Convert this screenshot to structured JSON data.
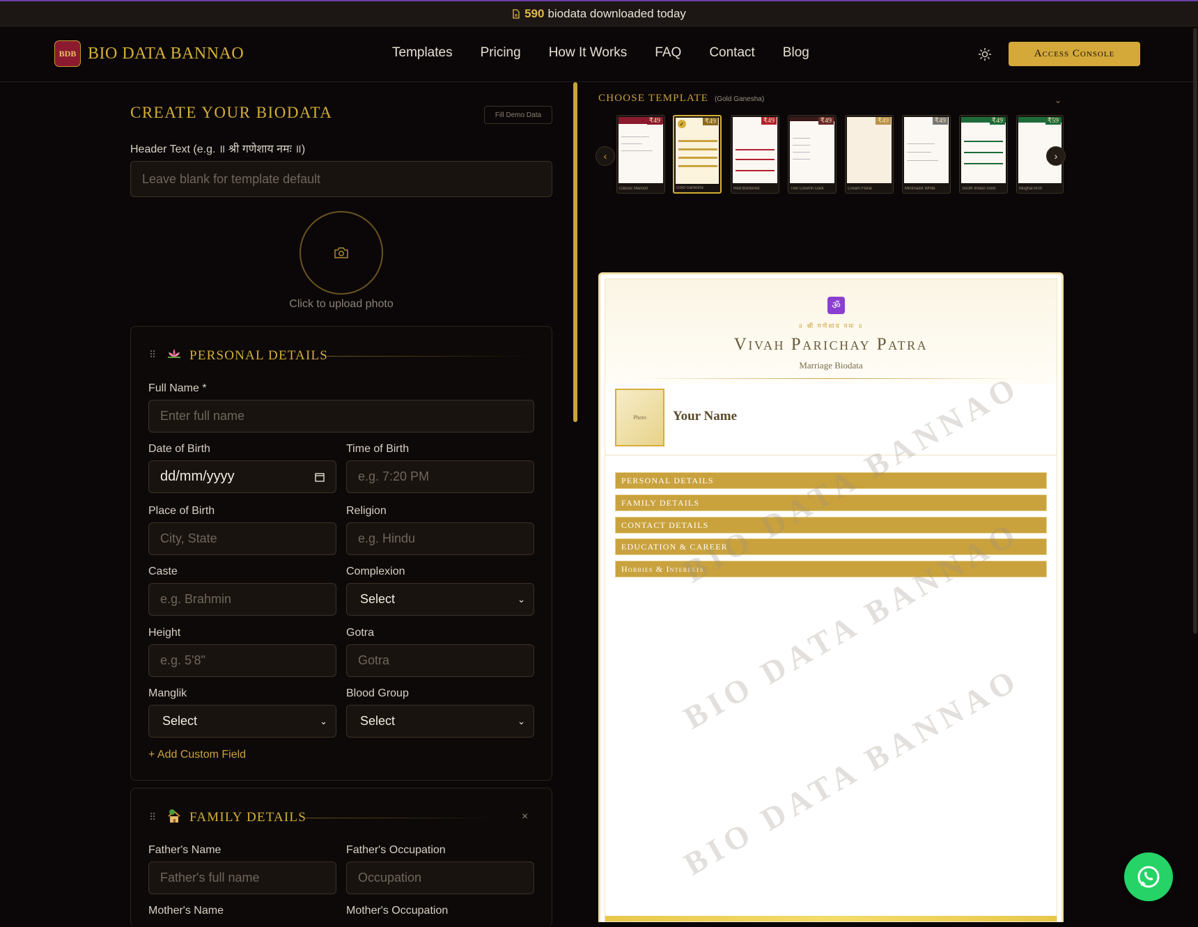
{
  "announcement": {
    "count": "590",
    "text": "biodata downloaded today"
  },
  "brand": {
    "badge": "BDB",
    "name": "BIO DATA BANNAO"
  },
  "nav": [
    "Templates",
    "Pricing",
    "How It Works",
    "FAQ",
    "Contact",
    "Blog"
  ],
  "console_button": "Access Console",
  "form": {
    "title": "CREATE YOUR BIODATA",
    "demo_button": "Fill Demo Data",
    "header_label": "Header Text (e.g. ॥ श्री गणेशाय नमः ॥)",
    "header_placeholder": "Leave blank for template default",
    "photo_label": "Click to upload photo",
    "personal": {
      "title": "PERSONAL DETAILS",
      "full_name_label": "Full Name *",
      "full_name_placeholder": "Enter full name",
      "dob_label": "Date of Birth",
      "dob_value": "dd/mm/yyyy",
      "tob_label": "Time of Birth",
      "tob_placeholder": "e.g. 7:20 PM",
      "pob_label": "Place of Birth",
      "pob_placeholder": "City, State",
      "religion_label": "Religion",
      "religion_placeholder": "e.g. Hindu",
      "caste_label": "Caste",
      "caste_placeholder": "e.g. Brahmin",
      "complexion_label": "Complexion",
      "complexion_value": "Select",
      "height_label": "Height",
      "height_placeholder": "e.g. 5'8\"",
      "gotra_label": "Gotra",
      "gotra_placeholder": "Gotra",
      "manglik_label": "Manglik",
      "manglik_value": "Select",
      "blood_label": "Blood Group",
      "blood_value": "Select",
      "add_custom": "+ Add Custom Field"
    },
    "family": {
      "title": "FAMILY DETAILS",
      "father_name_label": "Father's Name",
      "father_name_placeholder": "Father's full name",
      "father_occ_label": "Father's Occupation",
      "father_occ_placeholder": "Occupation",
      "mother_name_label": "Mother's Name",
      "mother_occ_label": "Mother's Occupation"
    }
  },
  "chooser": {
    "title": "CHOOSE TEMPLATE",
    "selected": "(Gold Ganesha)",
    "templates": [
      {
        "name": "Classic Maroon",
        "price": "₹49",
        "color": "#8b1a2e"
      },
      {
        "name": "Gold Ganesha",
        "price": "₹49",
        "color": "#c9a23e"
      },
      {
        "name": "Red Bordered",
        "price": "₹49",
        "color": "#b3202e"
      },
      {
        "name": "Two Column Dark",
        "price": "₹49",
        "color": "#3a1a1a"
      },
      {
        "name": "Cream Floral",
        "price": "₹49",
        "color": "#d8c8a0"
      },
      {
        "name": "Minimalist White",
        "price": "₹49",
        "color": "#888888"
      },
      {
        "name": "South Indian Gold",
        "price": "₹49",
        "color": "#1e6b3a"
      },
      {
        "name": "Mughal Arch",
        "price": "₹59",
        "color": "#1e6b3a"
      }
    ]
  },
  "preview": {
    "header": "॥ श्री गणेशाय नमः ॥",
    "title": "Vivah Parichay Patra",
    "subtitle": "Marriage Biodata",
    "photo": "Photo",
    "name": "Your Name",
    "sections": [
      "PERSONAL DETAILS",
      "FAMILY DETAILS",
      "CONTACT DETAILS",
      "EDUCATION & CAREER",
      "Hobbies & Interests"
    ],
    "watermark": "BIO DATA BANNAO"
  },
  "colors": {
    "accent": "#d4af37",
    "background": "#0b0708",
    "whatsapp": "#25d366"
  }
}
